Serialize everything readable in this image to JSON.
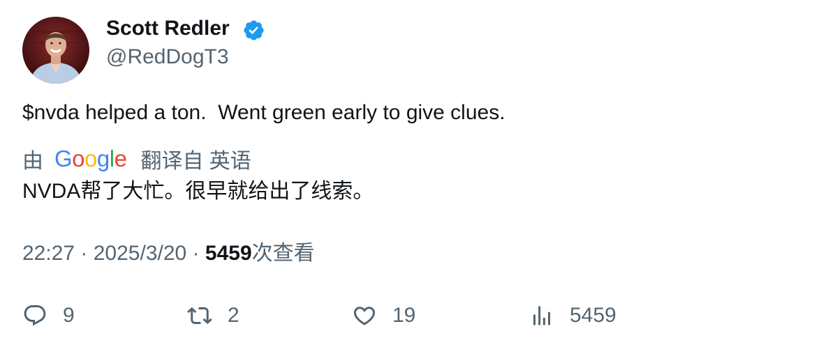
{
  "author": {
    "display_name": "Scott Redler",
    "handle": "@RedDogT3",
    "verified": true,
    "verified_color": "#1d9bf0",
    "avatar_icon": "profile-photo"
  },
  "tweet": {
    "text": "$nvda helped a ton.  Went green early to give clues."
  },
  "translation": {
    "prefix": "由",
    "provider_logo": "Google",
    "suffix": "翻译自 英语",
    "text": "NVDA帮了大忙。很早就给出了线索。"
  },
  "meta": {
    "time": "22:27",
    "separator1": " · ",
    "date": "2025/3/20",
    "separator2": " · ",
    "views_count": "5459",
    "views_label": "次查看"
  },
  "actions": {
    "reply": {
      "icon": "reply-icon",
      "count": "9"
    },
    "retweet": {
      "icon": "retweet-icon",
      "count": "2"
    },
    "like": {
      "icon": "heart-icon",
      "count": "19"
    },
    "views": {
      "icon": "analytics-icon",
      "count": "5459"
    }
  },
  "colors": {
    "text_primary": "#0f1419",
    "text_secondary": "#536471",
    "google_blue": "#4285f4",
    "google_red": "#ea4335",
    "google_yellow": "#fbbc05",
    "google_green": "#34a853"
  }
}
